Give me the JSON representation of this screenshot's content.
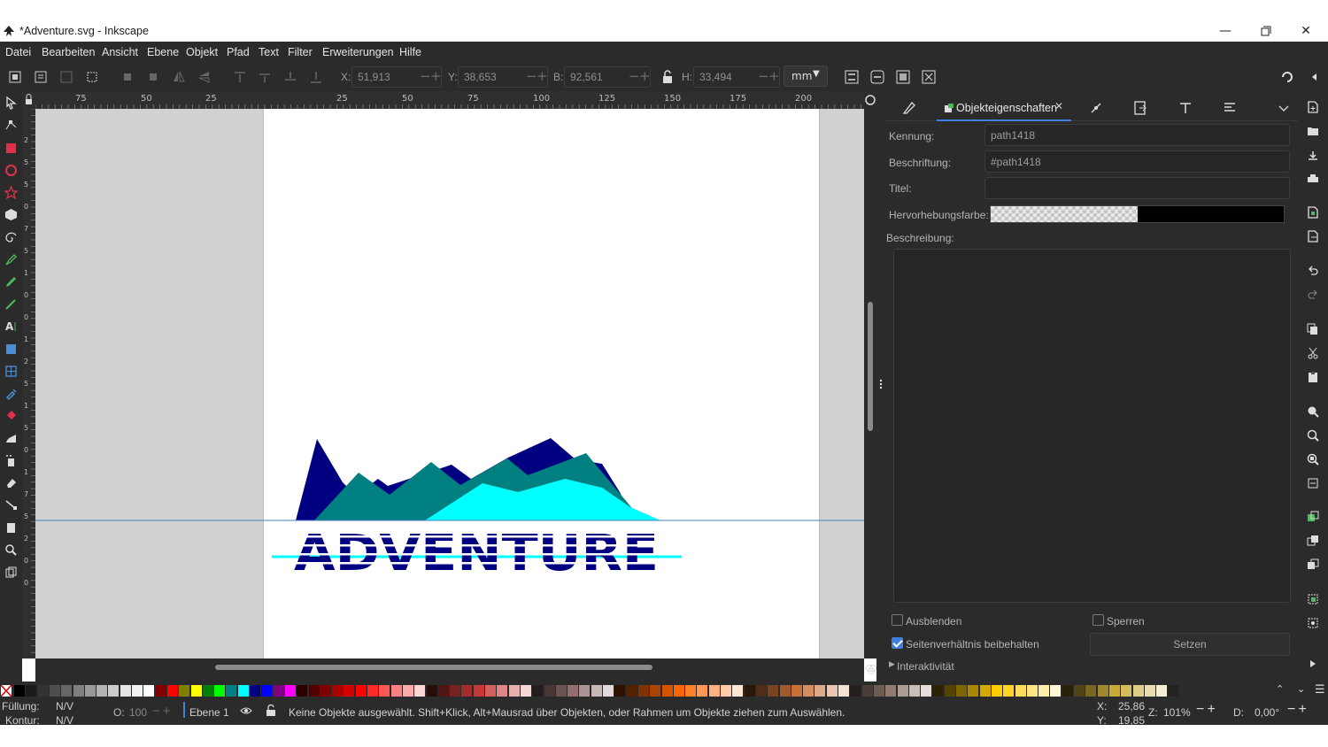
{
  "window": {
    "title": "*Adventure.svg - Inkscape",
    "controls": [
      "minimize-icon",
      "restore-icon",
      "close-icon"
    ]
  },
  "menu": {
    "items": [
      "Datei",
      "Bearbeiten",
      "Ansicht",
      "Ebene",
      "Objekt",
      "Pfad",
      "Text",
      "Filter",
      "Erweiterungen",
      "Hilfe"
    ]
  },
  "tool_controls": {
    "x_label": "X:",
    "x_value": "51,913",
    "y_label": "Y:",
    "y_value": "38,653",
    "w_label": "B:",
    "w_value": "92,561",
    "h_label": "H:",
    "h_value": "33,494",
    "unit": "mm"
  },
  "rulers": {
    "top_ticks": [
      "75",
      "50",
      "25",
      "25",
      "50",
      "75",
      "100",
      "125",
      "150",
      "175",
      "200"
    ],
    "left_ticks": [
      "2",
      "5",
      "5",
      "0",
      "7",
      "5",
      "1",
      "0",
      "0",
      "1",
      "2",
      "5",
      "1",
      "5",
      "0",
      "1",
      "7",
      "5",
      "2",
      "0",
      "0"
    ]
  },
  "canvas": {
    "logo_text": "ADVENTURE",
    "colors": {
      "navy": "#000080",
      "teal": "#008080",
      "cyan": "#00ffff",
      "guide": "#4a7fc1"
    }
  },
  "panel": {
    "active_tab": "Objekteigenschaften",
    "tab_icons": [
      "fill-stroke-icon",
      "object-properties-icon",
      "node-editor-icon",
      "export-icon",
      "text-icon",
      "align-icon",
      "tab-menu-chevron-icon"
    ],
    "fields": {
      "id_label": "Kennung:",
      "id_value": "path1418",
      "label_label": "Beschriftung:",
      "label_value": "#path1418",
      "title_label": "Titel:",
      "title_value": "",
      "highlight_label": "Hervorhebungsfarbe:",
      "description_label": "Beschreibung:"
    },
    "hide_label": "Ausblenden",
    "hide_checked": false,
    "lock_label": "Sperren",
    "lock_checked": false,
    "aspect_label": "Seitenverhältnis beibehalten",
    "aspect_checked": true,
    "set_button": "Setzen",
    "interactivity_label": "Interaktivität"
  },
  "palette": {
    "colors": [
      "#000000",
      "#1a1a1a",
      "#333333",
      "#4d4d4d",
      "#666666",
      "#808080",
      "#999999",
      "#b3b3b3",
      "#cccccc",
      "#e6e6e6",
      "#f2f2f2",
      "#ffffff",
      "#800000",
      "#ff0000",
      "#808000",
      "#ffff00",
      "#008000",
      "#00ff00",
      "#008080",
      "#00ffff",
      "#000080",
      "#0000ff",
      "#800080",
      "#ff00ff",
      "#2b0000",
      "#550000",
      "#800000",
      "#aa0000",
      "#d40000",
      "#ff0000",
      "#ff2a2a",
      "#ff5555",
      "#ff8080",
      "#ffaaaa",
      "#ffd5d5",
      "#280b0b",
      "#501616",
      "#782121",
      "#a02c2c",
      "#c83737",
      "#d35f5f",
      "#de8787",
      "#e9afaf",
      "#f4d7d7",
      "#241c1c",
      "#483737",
      "#6c5353",
      "#916f6f",
      "#ac9393",
      "#c8b7b7",
      "#e3dbdb",
      "#2b1100",
      "#552200",
      "#803300",
      "#aa4400",
      "#d45500",
      "#ff6600",
      "#ff7f2a",
      "#ff9955",
      "#ffb380",
      "#ffccaa",
      "#ffe6d5",
      "#28170b",
      "#502d16",
      "#784421",
      "#a05a2c",
      "#c87137",
      "#d38d5f",
      "#deaa87",
      "#e9c6af",
      "#f4e3d7",
      "#241f1c",
      "#483e37",
      "#6c5d53",
      "#917c6f",
      "#ac9d93",
      "#c8beb7",
      "#e3dedb",
      "#2b2200",
      "#554400",
      "#806600",
      "#aa8800",
      "#d4aa00",
      "#ffcc00",
      "#ffd42a",
      "#ffdd55",
      "#ffe680",
      "#ffeeaa",
      "#fff6d5",
      "#28220b",
      "#504416",
      "#786721",
      "#a0892c",
      "#c8ab37",
      "#d3bc5f",
      "#decd87",
      "#e9ddaf",
      "#f4eed7",
      "#24221c"
    ]
  },
  "status": {
    "fill_label": "Füllung:",
    "fill_value": "N/V",
    "stroke_label": "Kontur:",
    "stroke_value": "N/V",
    "opacity_label": "O:",
    "opacity_value": "100",
    "layer": "Ebene 1",
    "message": "Keine Objekte ausgewählt. Shift+Klick, Alt+Mausrad über Objekten, oder Rahmen um Objekte ziehen zum Auswählen.",
    "cursor_x_label": "X:",
    "cursor_x": "25,86",
    "cursor_y_label": "Y:",
    "cursor_y": "19,85",
    "zoom_label": "Z:",
    "zoom": "101%",
    "rotation_label": "D:",
    "rotation": "0,00°"
  }
}
